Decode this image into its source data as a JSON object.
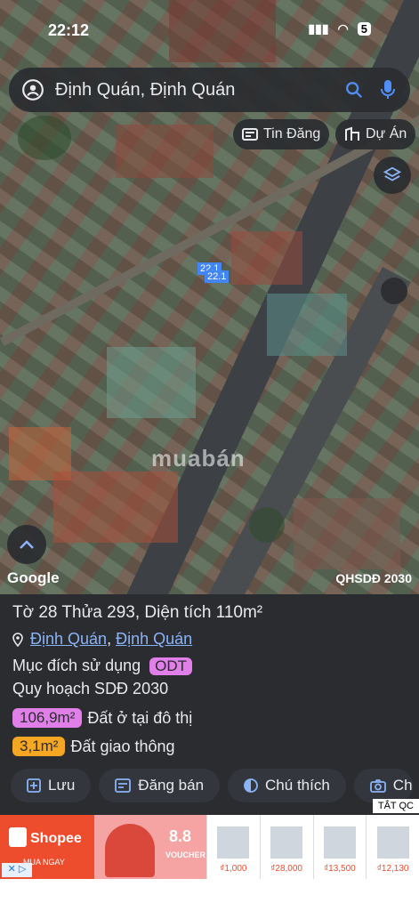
{
  "status_bar": {
    "time": "22:12",
    "battery": "5"
  },
  "search": {
    "text": "Định Quán, Định Quán"
  },
  "chips": {
    "tin_dang": "Tin Đăng",
    "du_an": "Dự Án"
  },
  "map": {
    "parcel_labels": [
      "22.1",
      "22.1"
    ],
    "watermark": "muabán",
    "google": "Google",
    "layer_label": "QHSDĐ 2030"
  },
  "parcel": {
    "title": "Tờ 28 Thửa 293, Diện tích 110m²",
    "location_1": "Định Quán",
    "location_sep": ",",
    "location_2": "Định Quán",
    "purpose_label": "Mục đích sử dụng",
    "purpose_code": "ODT",
    "plan_label": "Quy hoạch SDĐ 2030",
    "rows": [
      {
        "area": "106,9m²",
        "desc": "Đất ở tại đô thị",
        "color": "#e07fe8"
      },
      {
        "area": "3,1m²",
        "desc": "Đất giao thông",
        "color": "#f5a623"
      }
    ]
  },
  "actions": {
    "save": "Lưu",
    "post": "Đăng bán",
    "legend": "Chú thích",
    "photo": "Ch"
  },
  "ad": {
    "close": "TẮT QC",
    "shopee": "Shopee",
    "shopee_cta": "MUA NGAY",
    "promo_big": "8.8",
    "promo_small": "VOUCHER",
    "prices": [
      "₫1,000",
      "₫28,000",
      "₫13,500",
      "₫12,130"
    ]
  }
}
